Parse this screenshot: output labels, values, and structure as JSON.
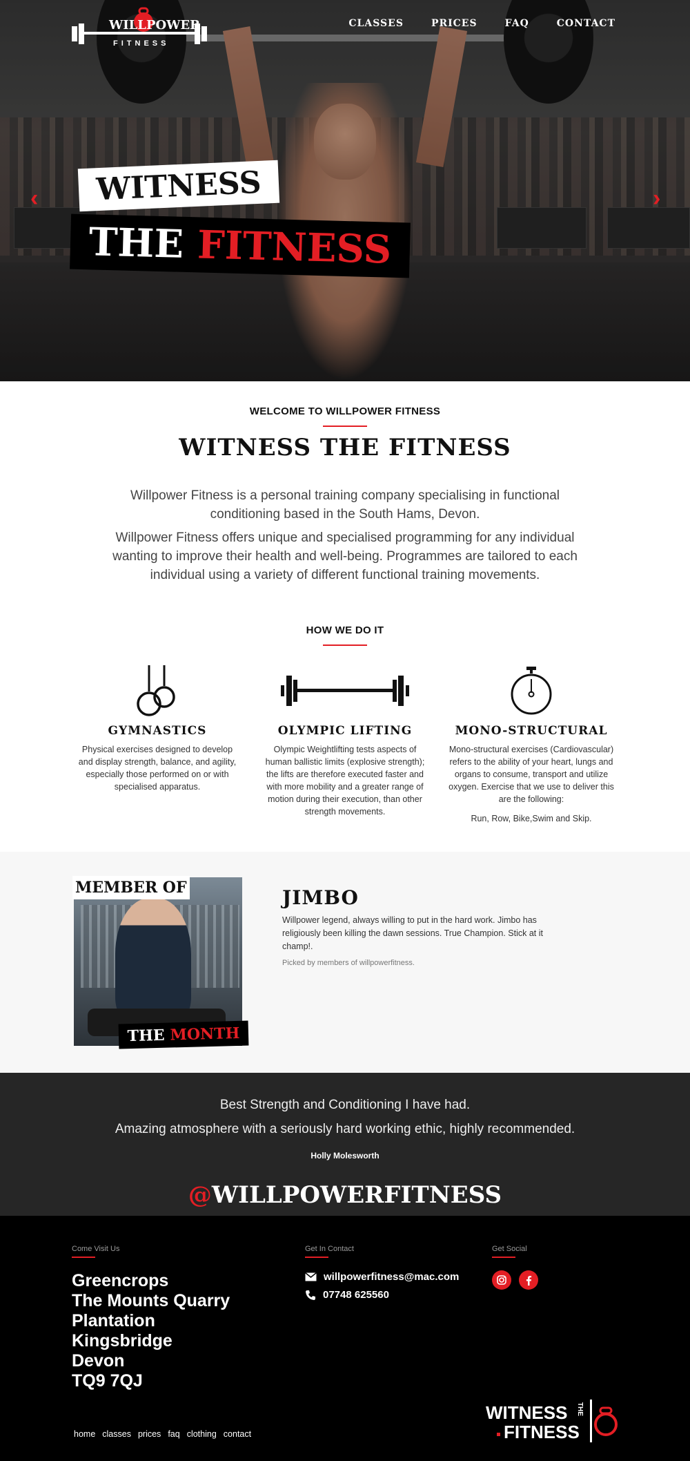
{
  "brand": {
    "logo_text": "WILLPOWER",
    "logo_sub": "FITNESS"
  },
  "nav": {
    "items": [
      "CLASSES",
      "PRICES",
      "FAQ",
      "CONTACT"
    ]
  },
  "hero": {
    "line1": "WITNESS",
    "line2_white": "THE",
    "line2_red": "FITNESS",
    "arrow_prev": "‹",
    "arrow_next": "›"
  },
  "welcome": {
    "label": "WELCOME TO WILLPOWER FITNESS",
    "title": "WITNESS THE FITNESS",
    "p1": "Willpower Fitness is a personal training company specialising in functional conditioning based in the South Hams, Devon.",
    "p2": "Willpower Fitness offers  unique and specialised programming for any individual wanting to improve their health and well-being.  Programmes are tailored to each individual using a variety of different functional training movements."
  },
  "how": {
    "label": "HOW WE DO IT",
    "items": [
      {
        "title": "GYMNASTICS",
        "icon": "rings-icon",
        "text": "Physical exercises designed to develop and display strength, balance, and agility, especially those performed on or with specialised apparatus."
      },
      {
        "title": "OLYMPIC LIFTING",
        "icon": "barbell-icon",
        "text": "Olympic Weightlifting tests aspects of human ballistic limits (explosive strength); the lifts are therefore executed faster and with more mobility and a greater range of motion during their execution, than other strength movements."
      },
      {
        "title": "MONO-STRUCTURAL",
        "icon": "stopwatch-icon",
        "text": "Mono-structural exercises (Cardiovascular) refers to the ability of your heart, lungs and organs to consume, transport and utilize oxygen. Exercise that we use to deliver this are the following:",
        "extra": "Run, Row, Bike,Swim and Skip."
      }
    ]
  },
  "member": {
    "badge_top": "MEMBER OF",
    "badge_bottom_white": "THE",
    "badge_bottom_red": "MONTH",
    "name": "JIMBO",
    "desc": "Willpower legend, always willing to put in the hard work. Jimbo has religiously been killing the dawn sessions. True Champion. Stick at it champ!.",
    "note": "Picked by members of willpowerfitness."
  },
  "testimonial": {
    "quote1": "Best Strength and Conditioning I have had.",
    "quote2": "Amazing atmosphere with a seriously hard working ethic, highly recommended.",
    "author": "Holly Molesworth"
  },
  "handle": {
    "at": "@",
    "name": "WILLPOWERFITNESS"
  },
  "footer": {
    "visit_label": "Come Visit Us",
    "address": [
      "Greencrops",
      "The Mounts Quarry",
      "Plantation",
      "Kingsbridge",
      "Devon",
      "TQ9 7QJ"
    ],
    "contact_label": "Get In Contact",
    "email": "willpowerfitness@mac.com",
    "phone": "07748 625560",
    "social_label": "Get Social",
    "links": [
      "home",
      "classes",
      "prices",
      "faq",
      "clothing",
      "contact"
    ],
    "logo_line1": "WITNESS",
    "logo_line2": "FITNESS",
    "logo_the": "THE"
  },
  "colors": {
    "accent": "#e31e24",
    "dark": "#262626",
    "footer": "#000000"
  }
}
